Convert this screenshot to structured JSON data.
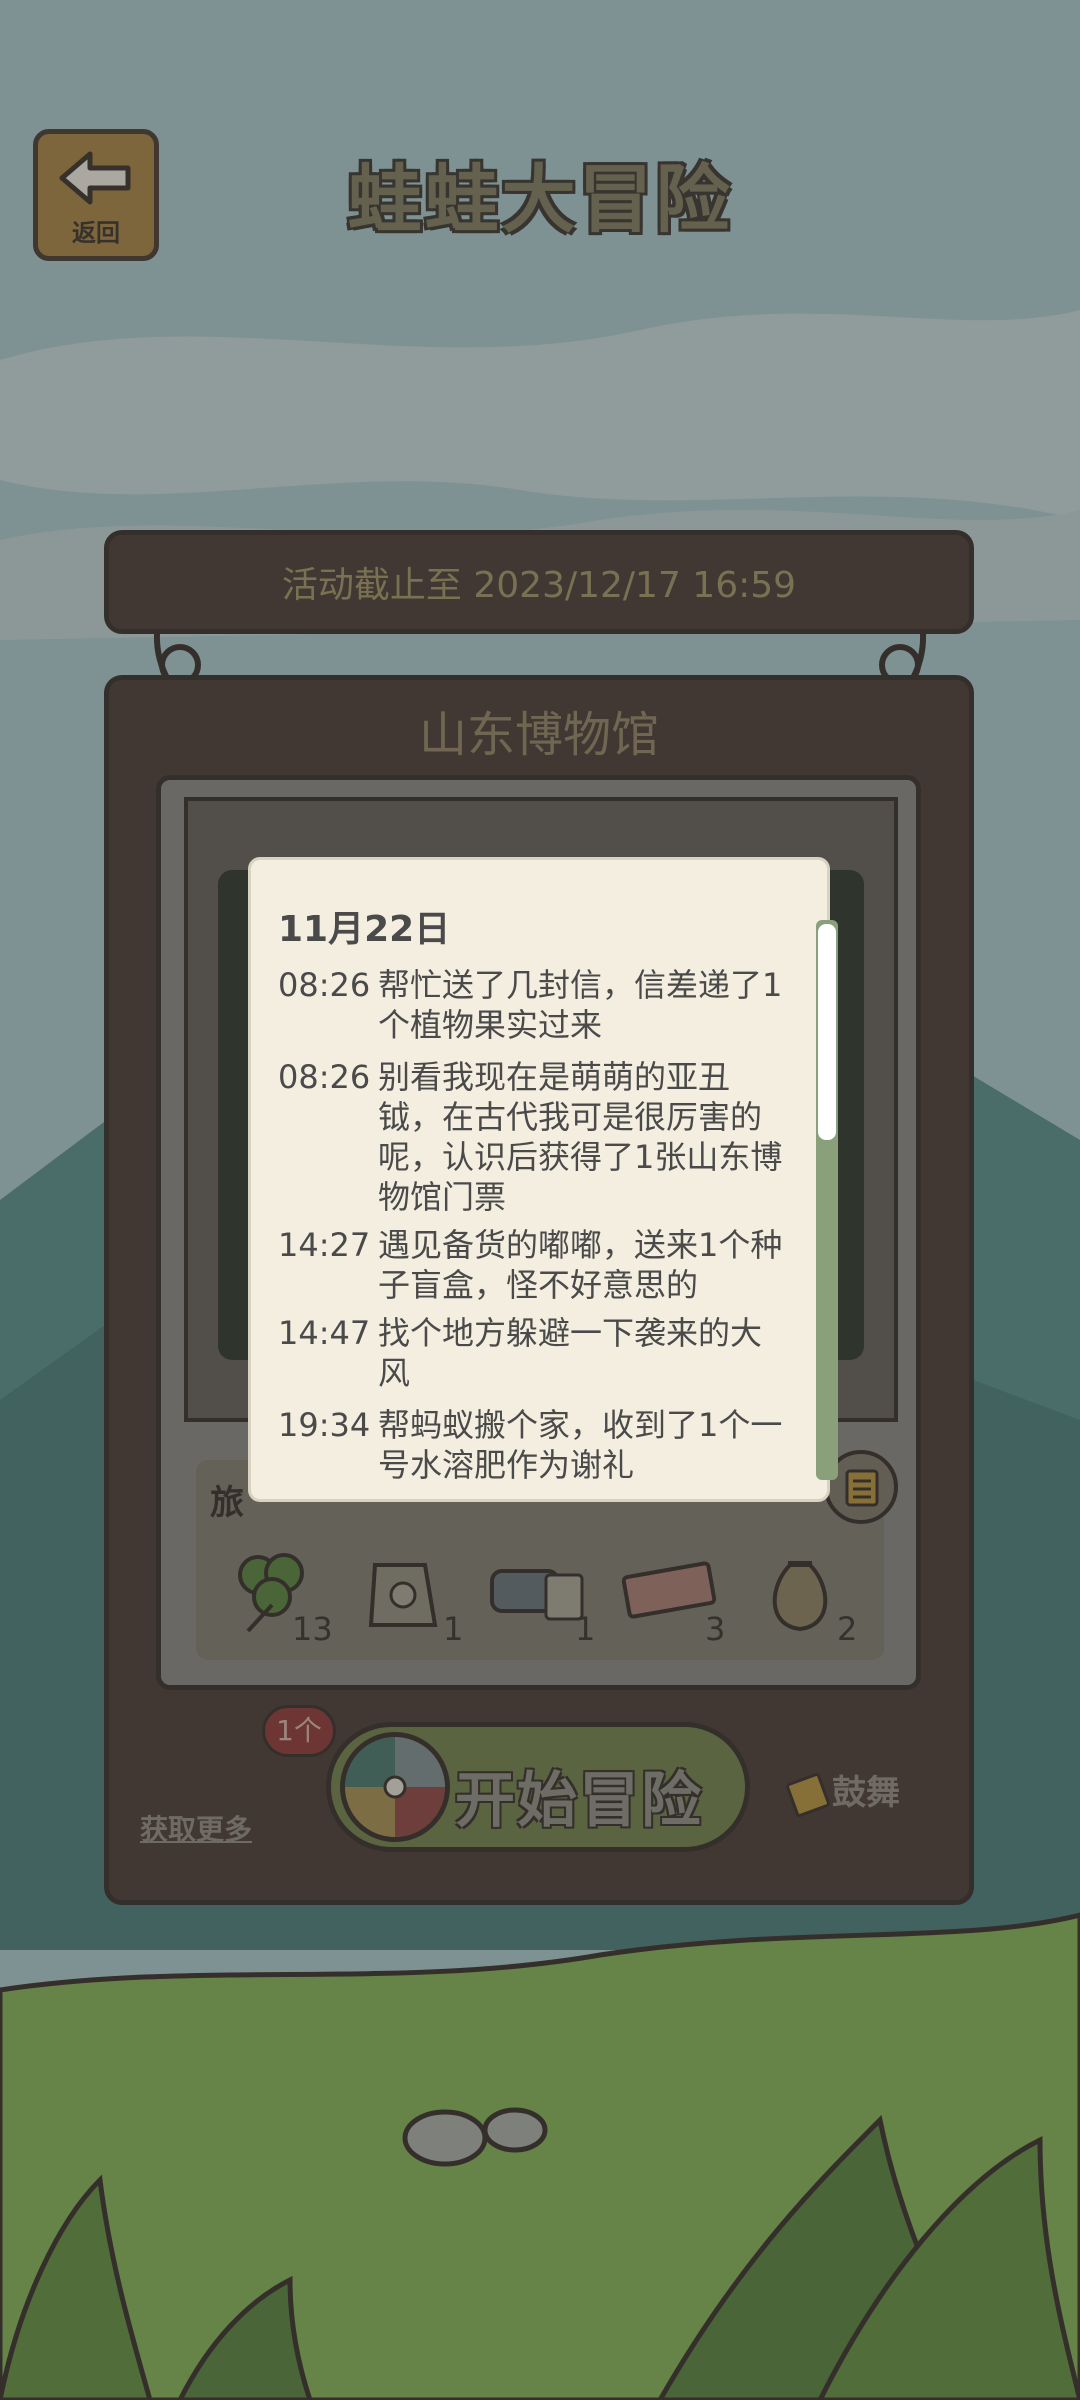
{
  "app": {
    "title": "蛙蛙大冒险",
    "back_label": "返回"
  },
  "event": {
    "deadline": "活动截止至 2023/12/17 16:59",
    "location": "山东博物馆"
  },
  "items_panel": {
    "header_partial": "旅",
    "items": [
      {
        "icon": "clover-icon",
        "count": "13"
      },
      {
        "icon": "bag-icon",
        "count": "1"
      },
      {
        "icon": "lantern-icon",
        "count": "1"
      },
      {
        "icon": "ticket-icon",
        "count": "3"
      },
      {
        "icon": "sack-icon",
        "count": "2"
      }
    ]
  },
  "controls": {
    "start_label": "开始冒险",
    "ticket_badge": "1个",
    "get_more": "获取更多",
    "cheer": "鼓舞"
  },
  "journal": {
    "date": "11月22日",
    "entries": [
      {
        "time": "08:26",
        "text": "帮忙送了几封信，信差递了1个植物果实过来"
      },
      {
        "time": "08:26",
        "text": "别看我现在是萌萌的亚丑钺，在古代我可是很厉害的呢，认识后获得了1张山东博物馆门票"
      },
      {
        "time": "14:27",
        "text": "遇见备货的嘟嘟，送来1个种子盲盒，怪不好意思的"
      },
      {
        "time": "14:47",
        "text": "找个地方躲避一下袭来的大风"
      },
      {
        "time": "19:34",
        "text": "帮蚂蚁搬个家，收到了1个一号水溶肥作为谢礼"
      }
    ]
  }
}
